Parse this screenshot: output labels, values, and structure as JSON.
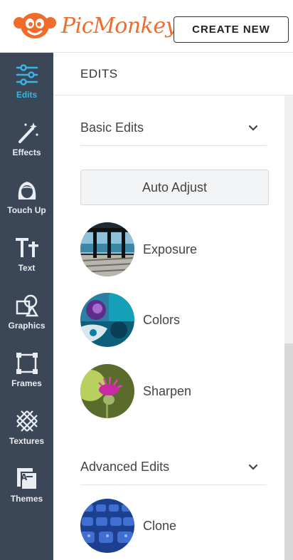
{
  "brand": {
    "name": "PicMonkey",
    "color": "#f26b2a"
  },
  "header": {
    "create_label": "CREATE NEW"
  },
  "sidebar": {
    "bg_color": "#3b4656",
    "active_color": "#39b4e6",
    "items": [
      {
        "label": "Edits",
        "icon": "sliders-icon",
        "active": true
      },
      {
        "label": "Effects",
        "icon": "magic-wand-icon"
      },
      {
        "label": "Touch Up",
        "icon": "face-icon"
      },
      {
        "label": "Text",
        "icon": "text-tt-icon"
      },
      {
        "label": "Graphics",
        "icon": "shapes-icon"
      },
      {
        "label": "Frames",
        "icon": "frame-icon"
      },
      {
        "label": "Textures",
        "icon": "texture-grid-icon"
      },
      {
        "label": "Themes",
        "icon": "themes-icon"
      }
    ]
  },
  "main": {
    "title": "EDITS",
    "basic_section": {
      "title": "Basic Edits",
      "icon": "chevron-down-icon"
    },
    "auto_adjust_label": "Auto Adjust",
    "tools": [
      {
        "label": "Exposure"
      },
      {
        "label": "Colors"
      },
      {
        "label": "Sharpen"
      }
    ],
    "advanced_section": {
      "title": "Advanced Edits",
      "icon": "chevron-down-icon"
    },
    "advanced_tools": [
      {
        "label": "Clone"
      }
    ]
  }
}
